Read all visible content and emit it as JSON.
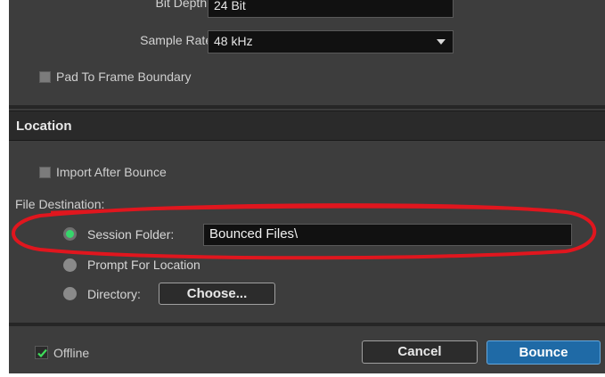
{
  "format": {
    "bit_depth": {
      "label": "Bit Depth:",
      "value": "24 Bit"
    },
    "sample_rate": {
      "label": "Sample Rate:",
      "value": "48 kHz"
    },
    "pad_to_frame": {
      "label": "Pad To Frame Boundary",
      "checked": false
    }
  },
  "location": {
    "header": "Location",
    "import_after_bounce": {
      "label": "Import After Bounce",
      "checked": false
    },
    "file_destination_label": "File Destination:",
    "session_folder": {
      "label": "Session Folder:",
      "value": "Bounced Files\\",
      "selected": true
    },
    "prompt_for_location": {
      "label": "Prompt For Location",
      "selected": false
    },
    "directory": {
      "label": "Directory:",
      "choose_button": "Choose...",
      "selected": false
    }
  },
  "footer": {
    "offline": {
      "label": "Offline",
      "checked": true
    },
    "cancel_label": "Cancel",
    "bounce_label": "Bounce"
  },
  "colors": {
    "panel": "#3d3d3d",
    "header": "#2a2a2a",
    "radio_selected": "#36d66b",
    "primary_button": "#1f6aa6",
    "annotation_circle": "#e0161e"
  }
}
